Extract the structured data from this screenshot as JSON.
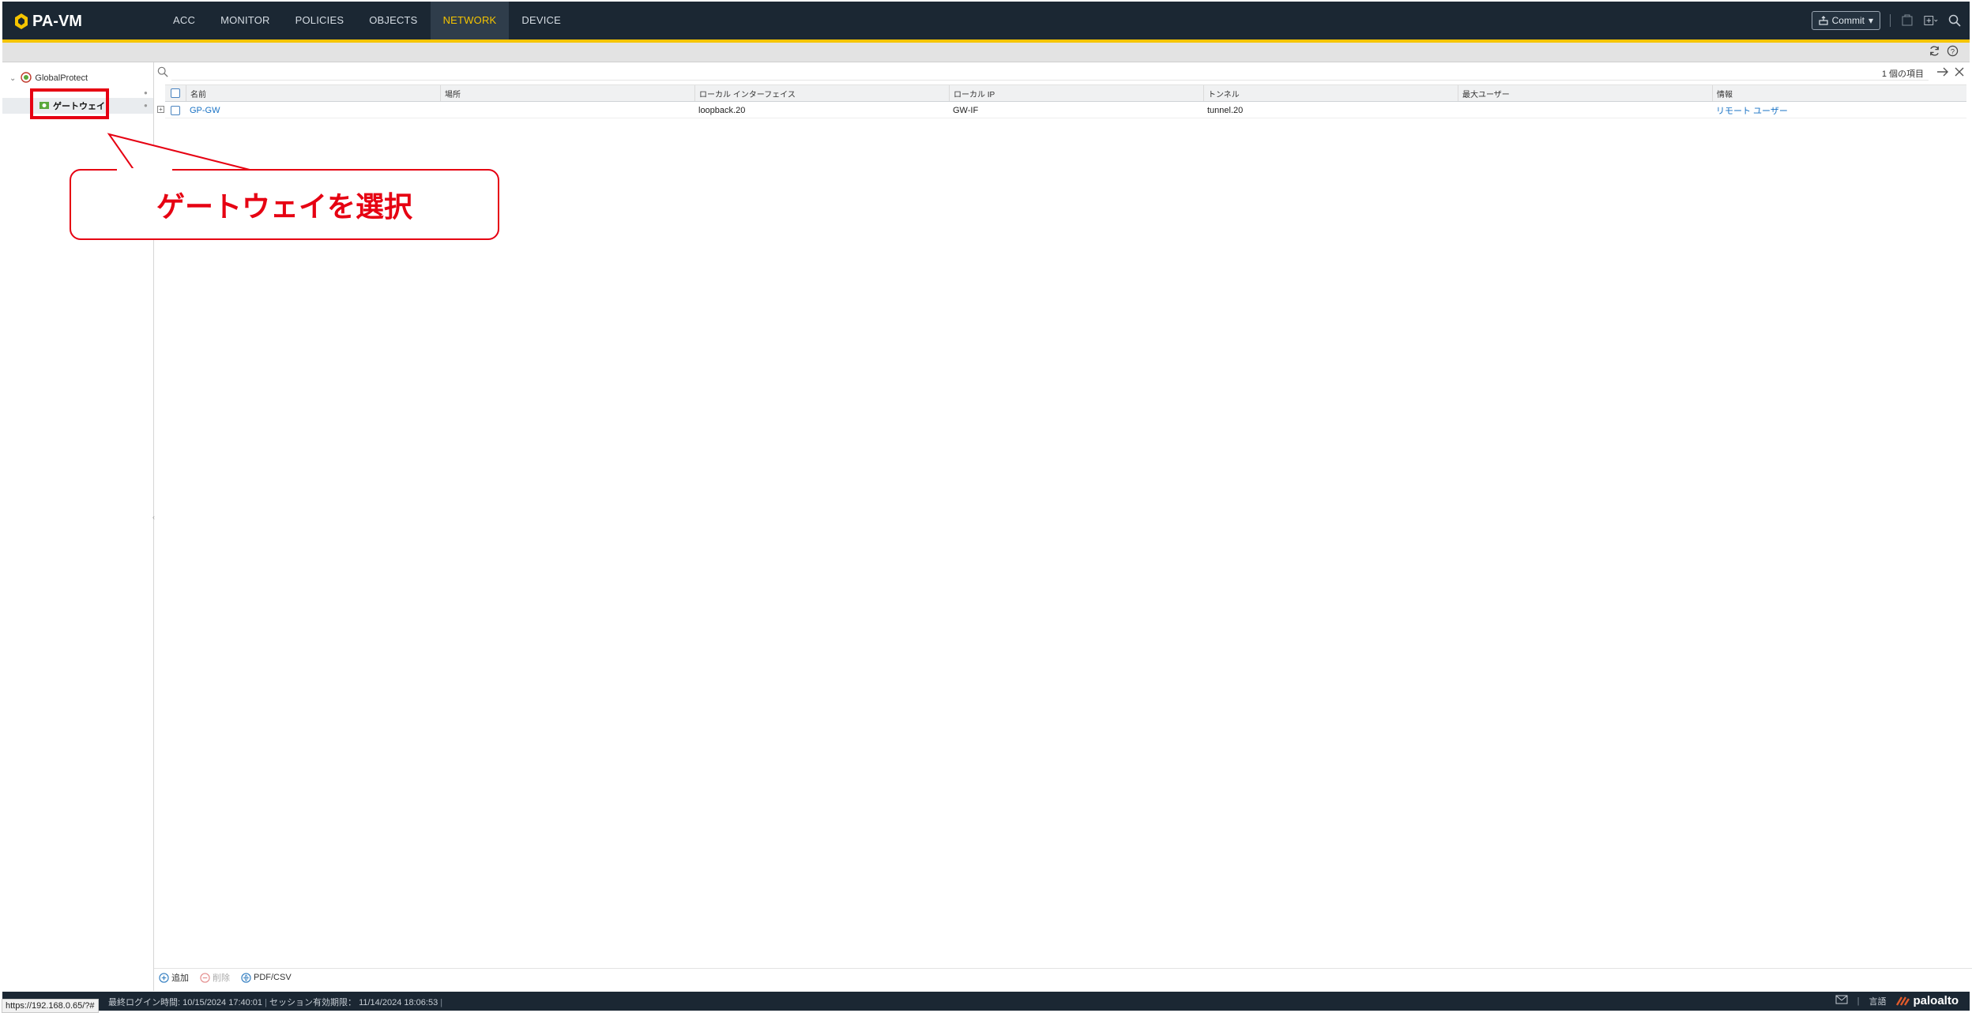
{
  "app": {
    "title": "PA-VM"
  },
  "nav": {
    "tabs": [
      {
        "label": "ACC"
      },
      {
        "label": "MONITOR"
      },
      {
        "label": "POLICIES"
      },
      {
        "label": "OBJECTS"
      },
      {
        "label": "NETWORK",
        "active": true
      },
      {
        "label": "DEVICE"
      }
    ],
    "commit_label": "Commit"
  },
  "sidebar": {
    "root_label": "GlobalProtect",
    "selected_label": "ゲートウェイ"
  },
  "callout": {
    "text": "ゲートウェイを選択"
  },
  "main": {
    "count_label": "1 個の項目",
    "columns": [
      "名前",
      "場所",
      "ローカル インターフェイス",
      "ローカル IP",
      "トンネル",
      "最大ユーザー",
      "情報"
    ],
    "rows": [
      {
        "name": "GP-GW",
        "location": "",
        "local_interface": "loopback.20",
        "local_ip": "GW-IF",
        "tunnel": "tunnel.20",
        "max_users": "",
        "info": "リモート ユーザー"
      }
    ],
    "actions": {
      "add": "追加",
      "delete": "削除",
      "pdf_csv": "PDF/CSV"
    }
  },
  "status": {
    "url": "https://192.168.0.65/?#",
    "last_login": "最終ログイン時間: 10/15/2024 17:40:01",
    "session_expiry": "セッション有効期限： 11/14/2024 18:06:53",
    "language": "言語",
    "brand": "paloalto"
  },
  "colors": {
    "accent": "#f5c400",
    "topbar": "#1b2733",
    "callout": "#e60012",
    "link": "#1a73c5"
  }
}
